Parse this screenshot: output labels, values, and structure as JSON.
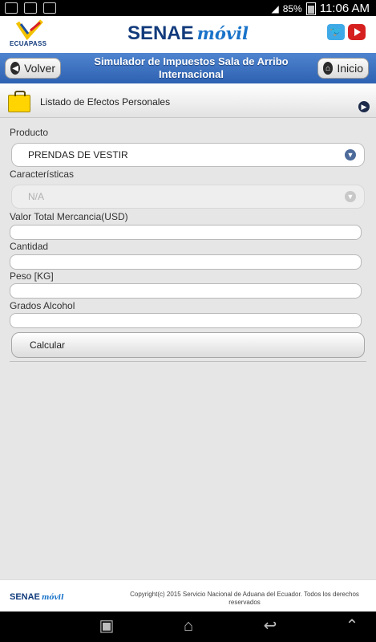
{
  "statusbar": {
    "battery": "85%",
    "time": "11:06 AM"
  },
  "header": {
    "logo_text": "ECUAPASS",
    "title_main": "SENAE",
    "title_accent": "móvil"
  },
  "nav": {
    "back_label": "Volver",
    "title": "Simulador de Impuestos Sala de Arribo Internacional",
    "home_label": "Inicio"
  },
  "section": {
    "title": "Listado de Efectos Personales"
  },
  "form": {
    "producto_label": "Producto",
    "producto_value": "PRENDAS DE VESTIR",
    "caracteristicas_label": "Características",
    "caracteristicas_value": "N/A",
    "valor_label": "Valor Total Mercancia(USD)",
    "cantidad_label": "Cantidad",
    "peso_label": "Peso [KG]",
    "grados_label": "Grados Alcohol",
    "calcular_label": "Calcular"
  },
  "footer": {
    "logo_main": "SENAE",
    "logo_accent": "móvil",
    "copyright": "Copyright(c) 2015 Servicio Nacional de Aduana del Ecuador. Todos los derechos reservados"
  }
}
